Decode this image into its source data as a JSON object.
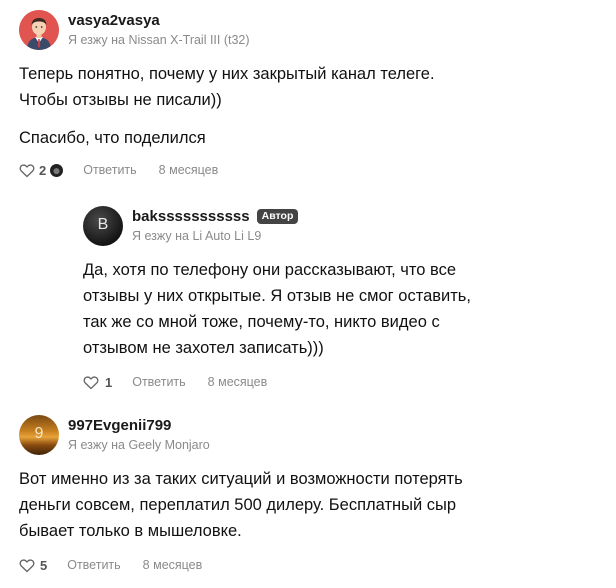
{
  "comments": [
    {
      "username": "vasya2vasya",
      "car": "Я езжу на Nissan X-Trail III (t32)",
      "paragraphs": [
        "Теперь понятно, почему у них закрытый канал телеге.",
        "Чтобы отзывы не писали))",
        "Спасибо, что поделился"
      ],
      "likes": "2",
      "reply_label": "Ответить",
      "time": "8 месяцев"
    },
    {
      "username": "baksssssssssss",
      "badge": "Автор",
      "car": "Я езжу на Li Auto Li L9",
      "avatar_letter": "B",
      "paragraphs": [
        "Да, хотя по телефону они рассказывают, что все",
        "отзывы у них открытые. Я отзыв не смог оставить,",
        "так же со мной тоже, почему-то, никто видео с",
        "отзывом не захотел записать)))"
      ],
      "likes": "1",
      "reply_label": "Ответить",
      "time": "8 месяцев"
    },
    {
      "username": "997Evgenii799",
      "car": "Я езжу на Geely Monjaro",
      "avatar_letter": "9",
      "paragraphs": [
        "Вот именно из за таких ситуаций и возможности потерять",
        "деньги совсем, переплатил 500 дилеру. Бесплатный сыр",
        "бывает только в мышеловке."
      ],
      "likes": "5",
      "reply_label": "Ответить",
      "time": "8 месяцев"
    }
  ],
  "colors": {
    "text": "#111111",
    "muted": "#8a8a8a",
    "badge_bg": "#444444",
    "avatar1_bg": "#e0554f",
    "avatar2_bg": "#2b2b2b"
  }
}
